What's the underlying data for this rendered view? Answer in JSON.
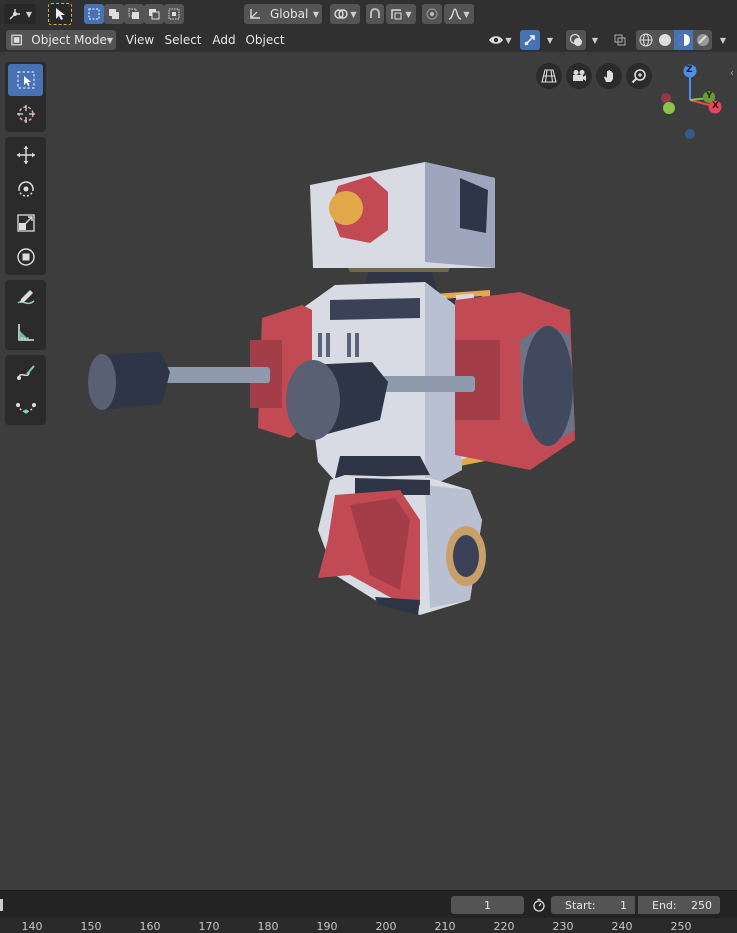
{
  "toolbar": {
    "transform_orientation": "Global",
    "mode": "Object Mode",
    "menus": [
      "View",
      "Select",
      "Add",
      "Object"
    ]
  },
  "gizmo": {
    "z": "Z",
    "y": "Y",
    "x": "X"
  },
  "timeline": {
    "current_frame": "1",
    "start_label": "Start:",
    "start_value": "1",
    "end_label": "End:",
    "end_value": "250"
  },
  "ruler": {
    "ticks": [
      "140",
      "150",
      "160",
      "170",
      "180",
      "190",
      "200",
      "210",
      "220",
      "230",
      "240",
      "250"
    ]
  },
  "colors": {
    "accent": "#4772b3",
    "robot_red": "#c24a55",
    "robot_white": "#d8dbe3",
    "robot_navy": "#2e3547",
    "robot_gold": "#e2a94a"
  }
}
